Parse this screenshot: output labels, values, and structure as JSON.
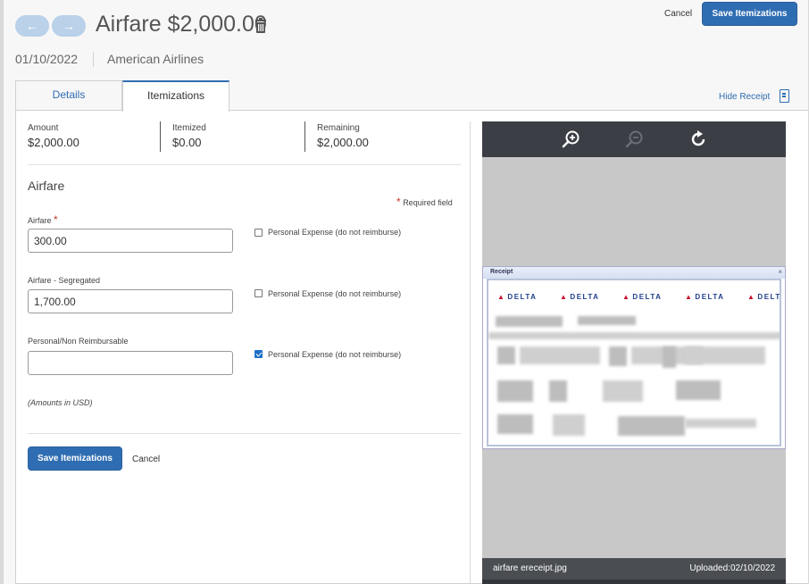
{
  "header": {
    "back_icon": "←",
    "forward_icon": "→",
    "title": "Airfare $2,000.00",
    "date": "01/10/2022",
    "vendor": "American Airlines",
    "cancel_label": "Cancel",
    "save_label": "Save Itemizations"
  },
  "tabs": [
    {
      "label": "Details",
      "active": false
    },
    {
      "label": "Itemizations",
      "active": true
    }
  ],
  "hide_receipt_label": "Hide Receipt",
  "summary": {
    "amount_label": "Amount",
    "amount_value": "$2,000.00",
    "itemized_label": "Itemized",
    "itemized_value": "$0.00",
    "remaining_label": "Remaining",
    "remaining_value": "$2,000.00"
  },
  "form": {
    "section_title": "Airfare",
    "required_note": "Required field",
    "required_star": "*",
    "fields": [
      {
        "label": "Airfare",
        "value": "300.00",
        "required": true,
        "personal_label": "Personal Expense (do not reimburse)",
        "personal_checked": false
      },
      {
        "label": "Airfare - Segregated",
        "value": "1,700.00",
        "required": false,
        "personal_label": "Personal Expense (do not reimburse)",
        "personal_checked": false
      },
      {
        "label": "Personal/Non Reimbursable",
        "value": "",
        "required": false,
        "personal_label": "Personal Expense (do not reimburse)",
        "personal_checked": true
      }
    ],
    "amounts_note": "(Amounts in USD)",
    "save_label": "Save Itemizations",
    "cancel_label": "Cancel"
  },
  "receipt_viewer": {
    "tools": [
      "zoom-in-icon",
      "zoom-out-icon",
      "rotate-icon"
    ],
    "window_title": "Receipt",
    "close_glyph": "×",
    "logo_text": "DELTA",
    "filename": "airfare ereceipt.jpg",
    "uploaded": "Uploaded:02/10/2022"
  },
  "colors": {
    "primary": "#2f6db2",
    "nav_button": "#b9d1e9",
    "required": "#c0392b",
    "viewer_toolbar": "#3b3f45"
  }
}
